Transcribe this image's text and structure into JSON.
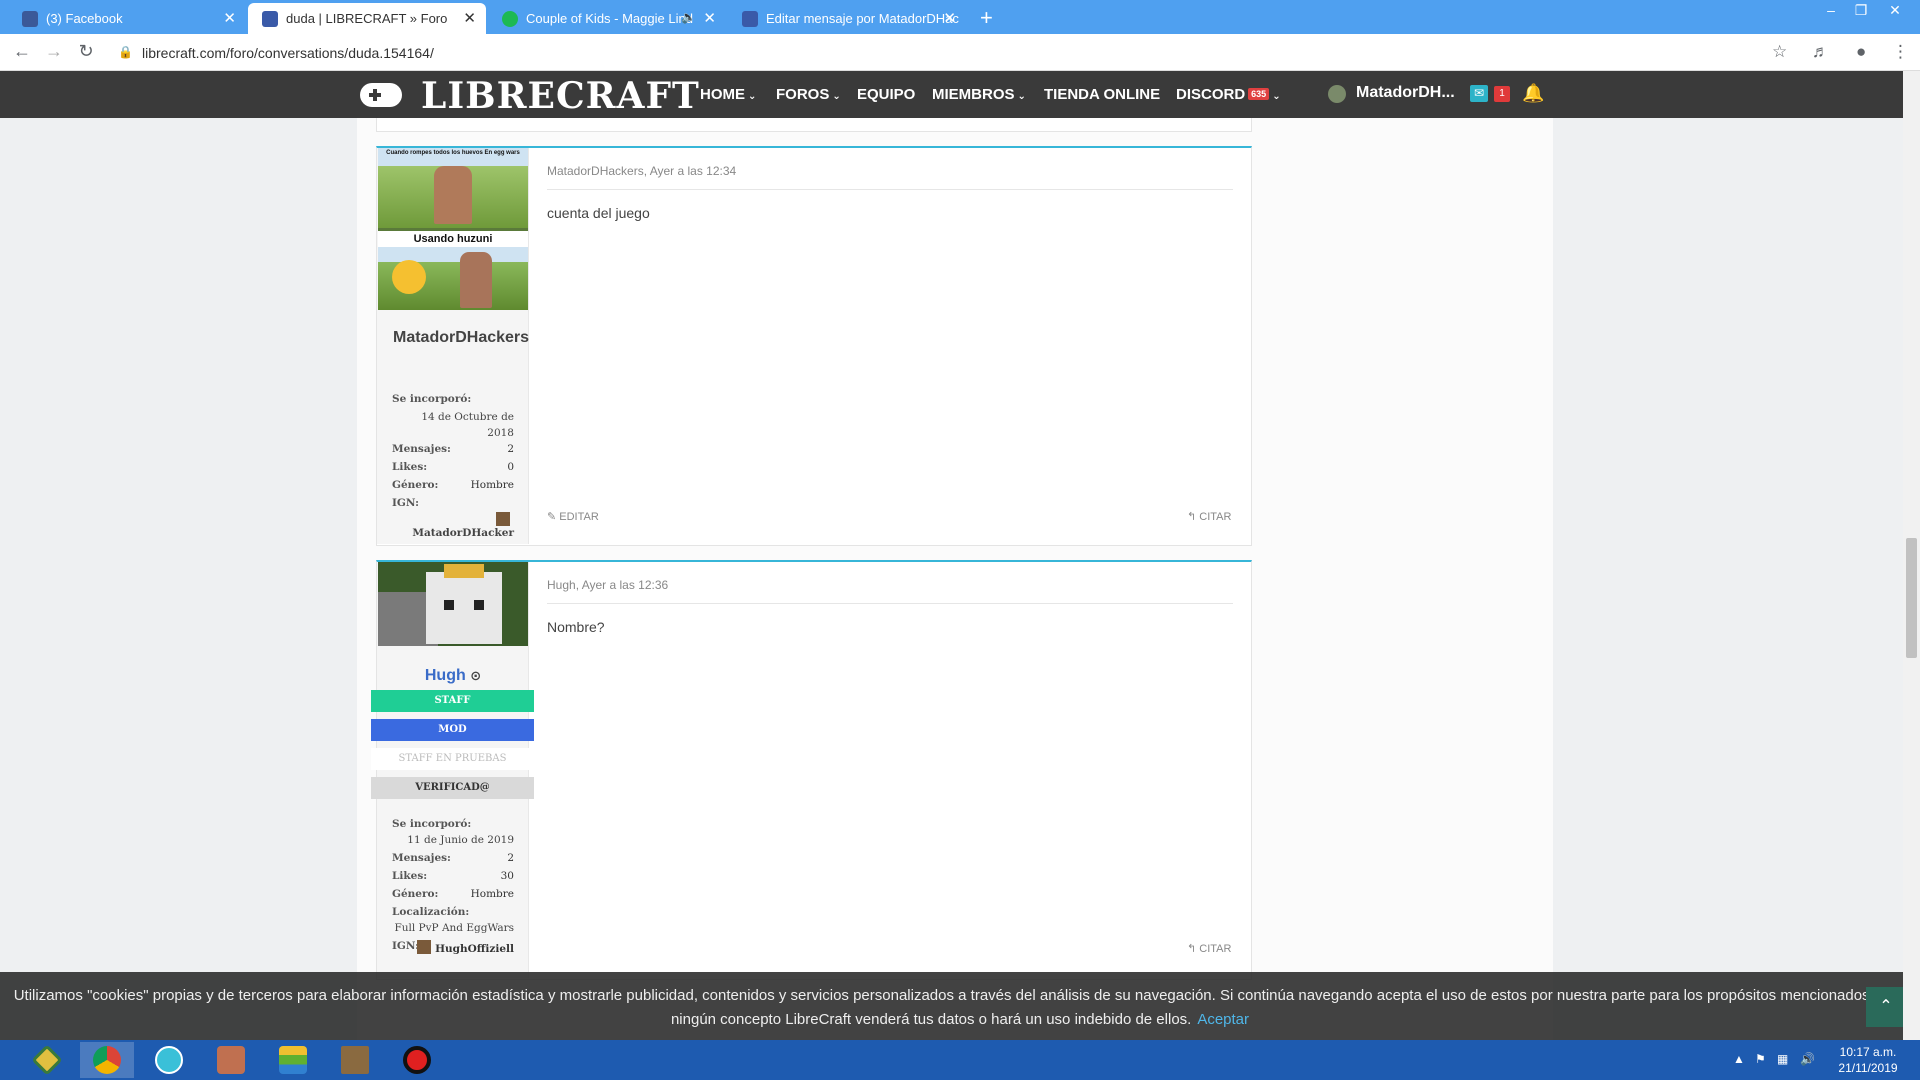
{
  "browser": {
    "tabs": [
      {
        "title": "(3) Facebook",
        "favicon_color": "#3b5998"
      },
      {
        "title": "duda | LIBRECRAFT » Foro",
        "favicon_color": "#3a5aa8"
      },
      {
        "title": "Couple of Kids - Maggie Lind",
        "favicon_color": "#1db954"
      },
      {
        "title": "Editar mensaje por MatadorDHac",
        "favicon_color": "#3a5aa8"
      }
    ],
    "url": "librecraft.com/foro/conversations/duda.154164/"
  },
  "site": {
    "logo": "LIBRECRAFT",
    "nav": [
      {
        "label": "HOME",
        "chevron": true
      },
      {
        "label": "FOROS",
        "chevron": true
      },
      {
        "label": "EQUIPO",
        "chevron": false
      },
      {
        "label": "MIEMBROS",
        "chevron": true
      },
      {
        "label": "TIENDA ONLINE",
        "chevron": false
      },
      {
        "label": "DISCORD",
        "chevron": true,
        "badge": "635"
      }
    ],
    "user": "MatadorDH...",
    "inbox_count": "1"
  },
  "posts": [
    {
      "avatar_top_caption": "Cuando rompes todos los huevos En egg wars",
      "avatar_mid_caption": "Usando huzuni",
      "username": "MatadorDHackers",
      "meta": "MatadorDHackers, Ayer a las 12:34",
      "message": "cuenta del juego",
      "stats": {
        "joined_label": "Se incorporó:",
        "joined_value": "14 de Octubre de 2018",
        "messages_label": "Mensajes:",
        "messages": "2",
        "likes_label": "Likes:",
        "likes": "0",
        "gender_label": "Género:",
        "gender": "Hombre",
        "ign_label": "IGN:",
        "ign": "MatadorDHacker"
      },
      "actions": {
        "edit": "EDITAR",
        "quote": "CITAR"
      }
    },
    {
      "username": "Hugh",
      "meta": "Hugh, Ayer a las 12:36",
      "message": "Nombre?",
      "roles": [
        {
          "label": "STAFF",
          "bg": "#1fce95",
          "color": "#ffffff"
        },
        {
          "label": "MOD",
          "bg": "#3a6ae0",
          "color": "#ffffff"
        },
        {
          "label": "STAFF EN PRUEBAS",
          "bg": "#ffffff",
          "color": "#bbbbbb"
        },
        {
          "label": "VERIFICAD@",
          "bg": "#d9d9d9",
          "color": "#333333"
        }
      ],
      "stats": {
        "joined_label": "Se incorporó:",
        "joined_value": "11 de Junio de 2019",
        "messages_label": "Mensajes:",
        "messages": "2",
        "likes_label": "Likes:",
        "likes": "30",
        "gender_label": "Género:",
        "gender": "Hombre",
        "location_label": "Localización:",
        "location": "Full PvP And EggWars",
        "ign_label": "IGN:",
        "ign": "HughOffiziell"
      },
      "actions": {
        "quote": "CITAR"
      }
    }
  ],
  "cookie": {
    "text": "Utilizamos \"cookies\" propias y de terceros para elaborar información estadística y mostrarle publicidad, contenidos y servicios personalizados a través del análisis de su navegación. Si continúa navegando acepta el uso de estos por nuestra parte para los propósitos mencionados; bajo ningún concepto LibreCraft venderá tus datos o hará un uso indebido de ellos.",
    "accept": "Aceptar"
  },
  "taskbar": {
    "time": "10:17 a.m.",
    "date": "21/11/2019"
  }
}
